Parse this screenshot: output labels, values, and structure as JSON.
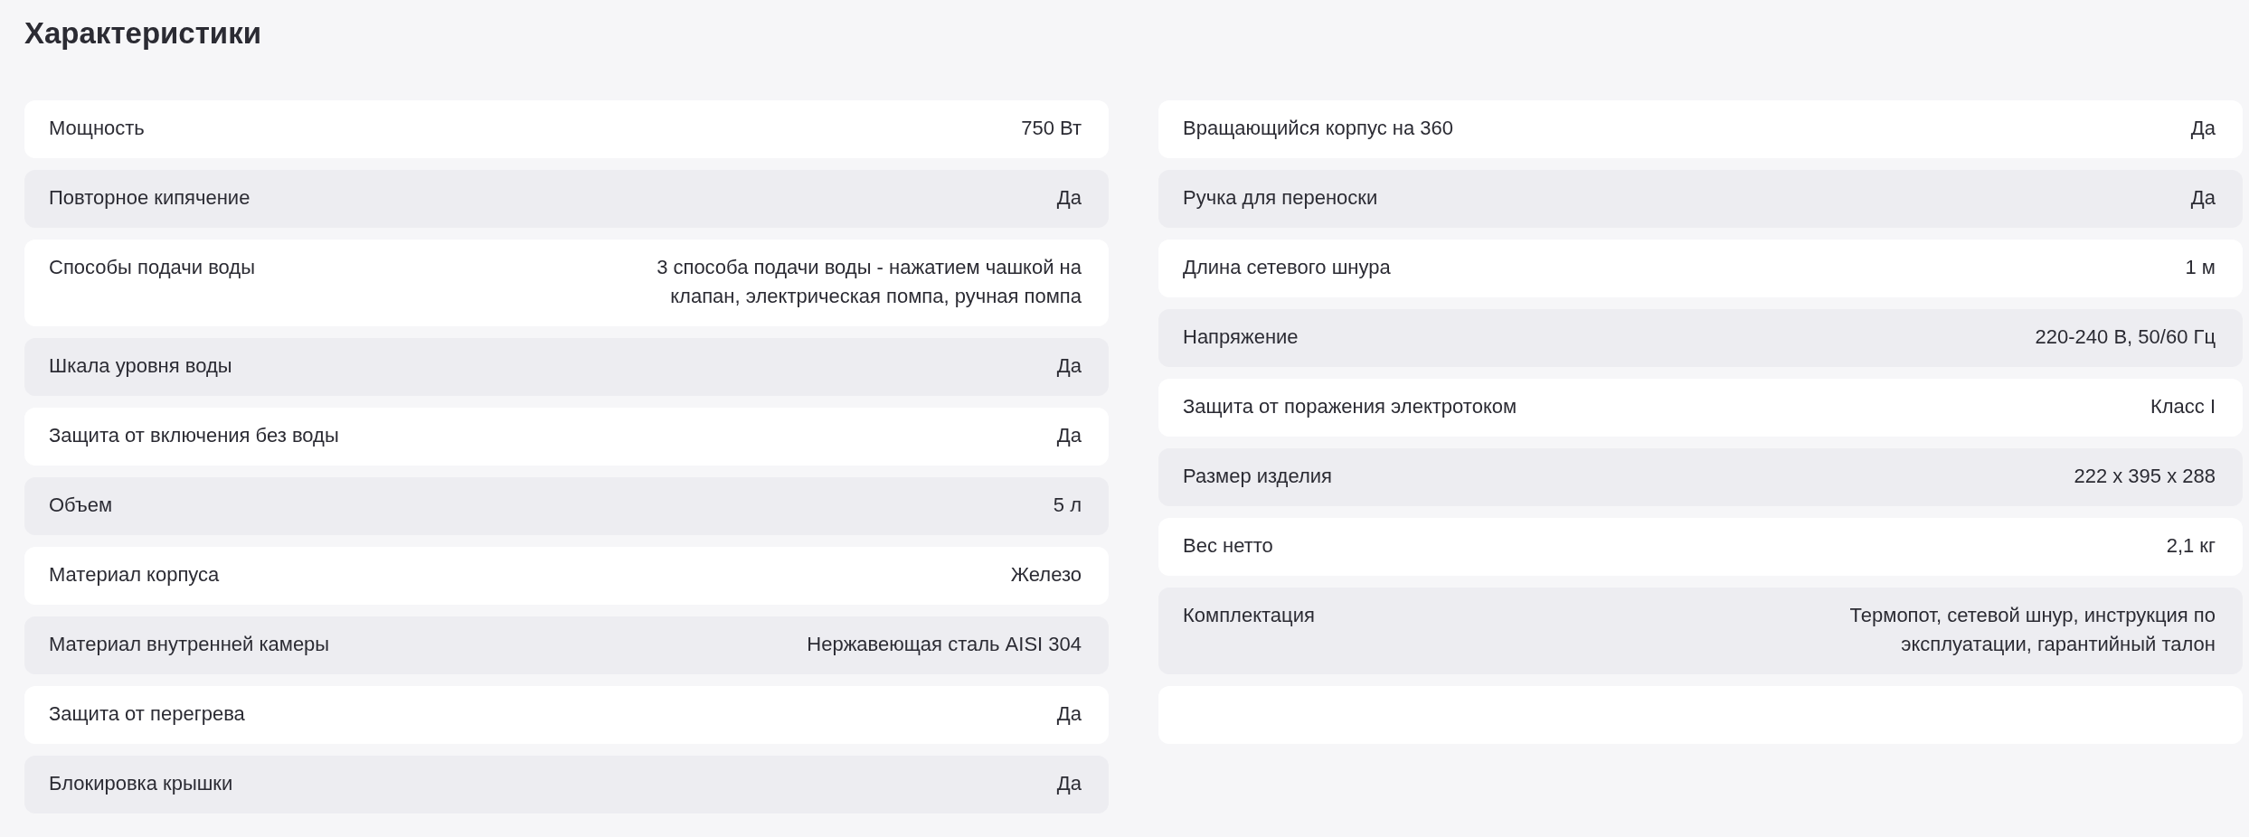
{
  "title": "Характеристики",
  "columns": [
    {
      "rows": [
        {
          "label": "Мощность",
          "value": "750 Вт"
        },
        {
          "label": "Повторное кипячение",
          "value": "Да"
        },
        {
          "label": "Способы подачи воды",
          "value": "3 способа подачи воды - нажатием чашкой на клапан, электрическая помпа, ручная помпа"
        },
        {
          "label": "Шкала уровня воды",
          "value": "Да"
        },
        {
          "label": "Защита от включения без воды",
          "value": "Да"
        },
        {
          "label": "Объем",
          "value": "5 л"
        },
        {
          "label": "Материал корпуса",
          "value": "Железо"
        },
        {
          "label": "Материал внутренней камеры",
          "value": "Нержавеющая сталь AISI 304"
        },
        {
          "label": "Защита от перегрева",
          "value": "Да"
        },
        {
          "label": "Блокировка крышки",
          "value": "Да"
        }
      ]
    },
    {
      "rows": [
        {
          "label": "Вращающийся корпус на 360",
          "value": "Да"
        },
        {
          "label": "Ручка для переноски",
          "value": "Да"
        },
        {
          "label": "Длина сетевого шнура",
          "value": "1 м"
        },
        {
          "label": "Напряжение",
          "value": "220-240 В, 50/60 Гц"
        },
        {
          "label": "Защита от поражения электротоком",
          "value": "Класс I"
        },
        {
          "label": "Размер изделия",
          "value": "222 x 395 x 288"
        },
        {
          "label": "Вес нетто",
          "value": "2,1 кг"
        },
        {
          "label": "Комплектация",
          "value": "Термопот, сетевой шнур, инструкция по эксплуатации, гарантийный талон"
        }
      ],
      "trailing_blank_card": true
    }
  ]
}
